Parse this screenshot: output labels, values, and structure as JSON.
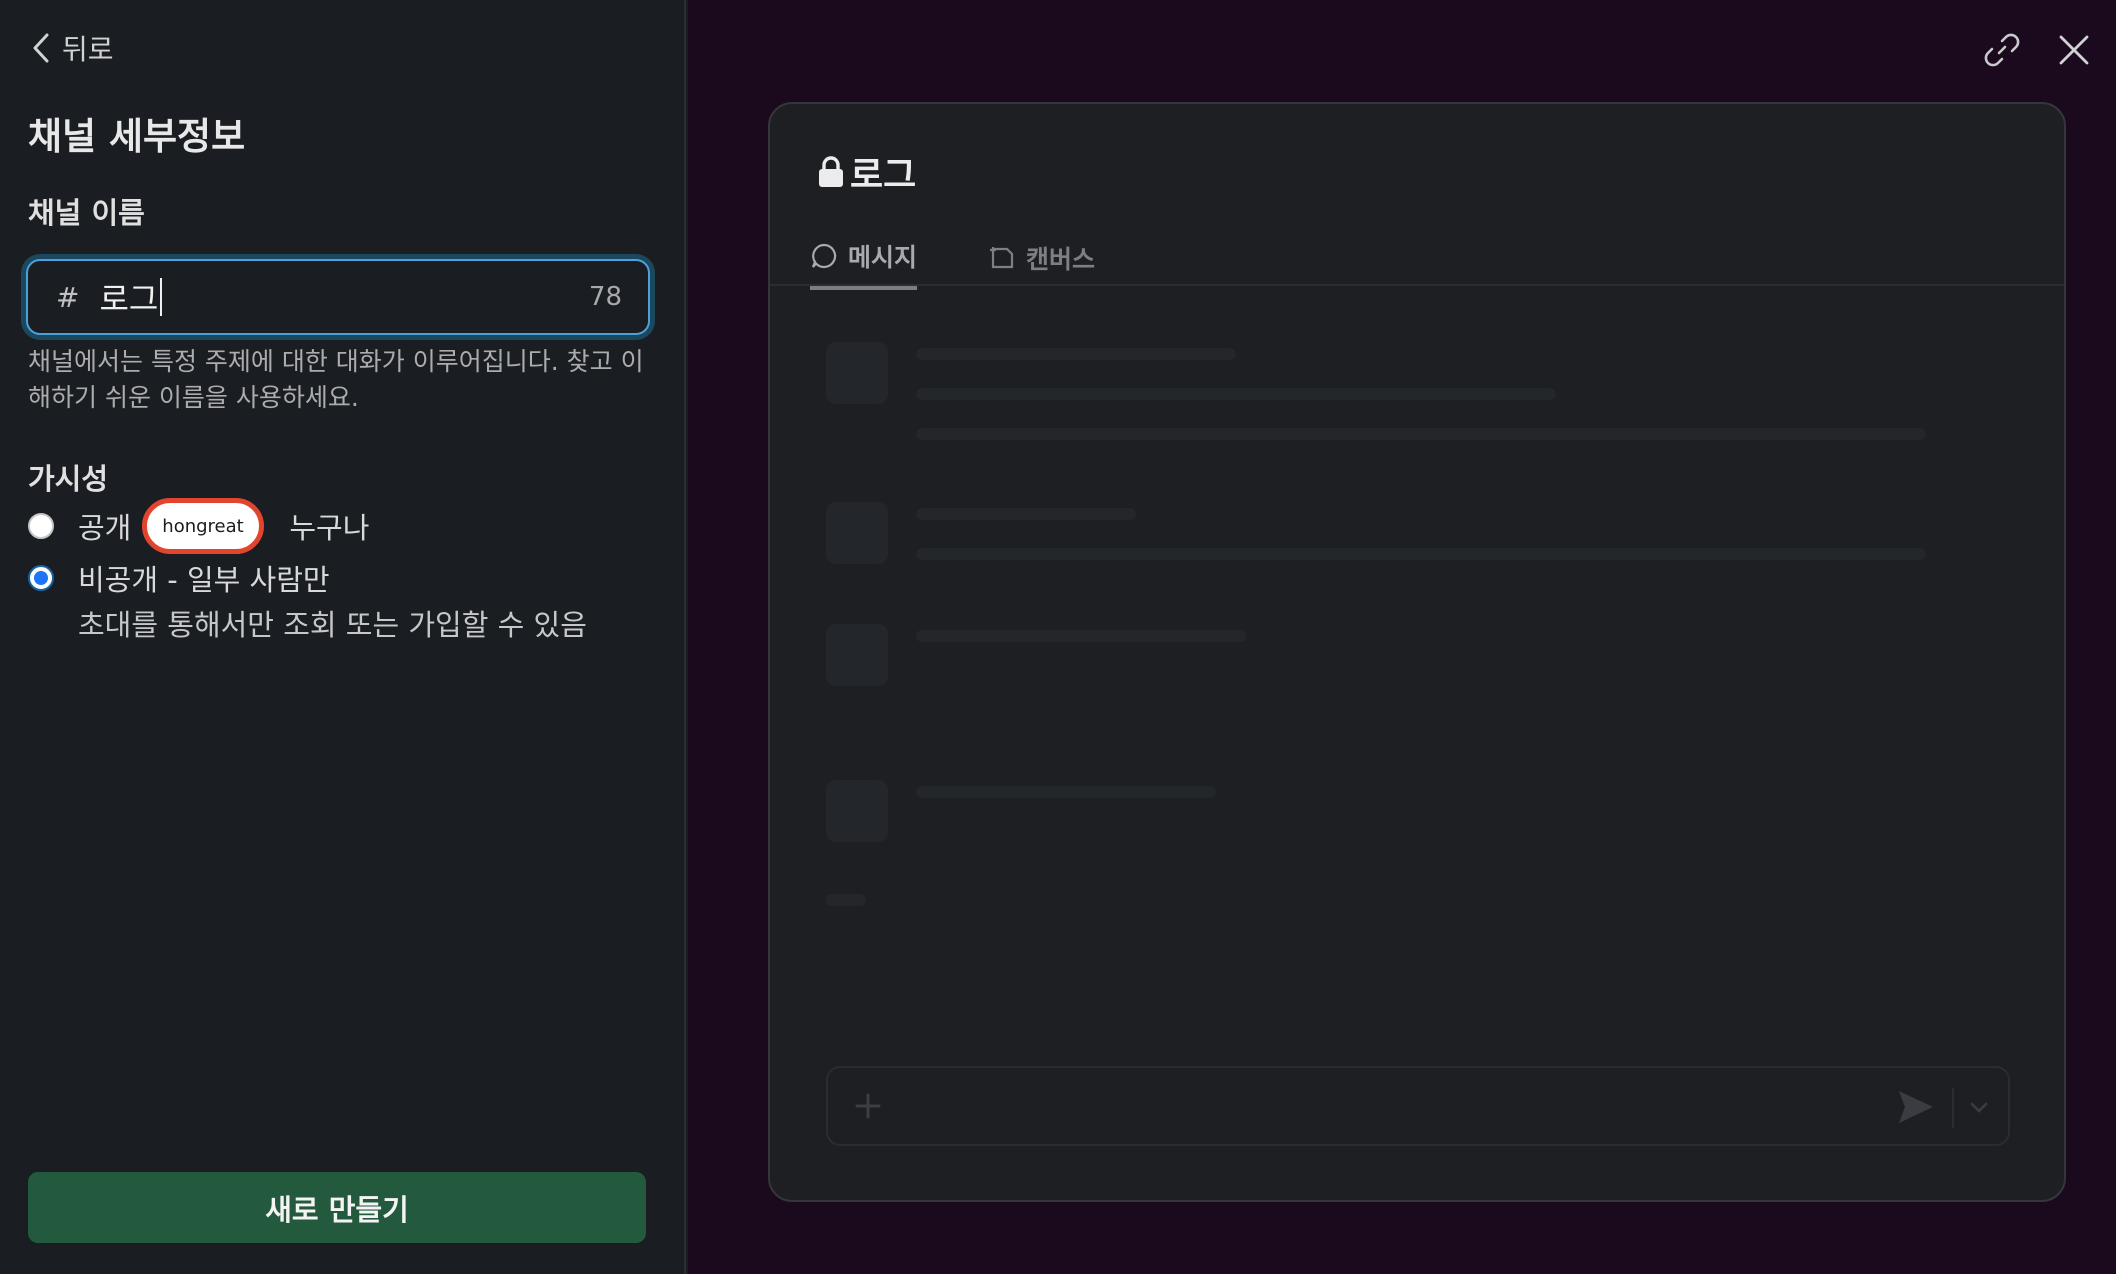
{
  "header": {
    "back_label": "뒤로"
  },
  "form": {
    "title": "채널 세부정보",
    "name_label": "채널 이름",
    "name_prefix": "#",
    "name_value": "로그",
    "name_remaining": "78",
    "hint": "채널에서는 특정 주제에 대한 대화가 이루어집니다. 찾고 이해하기 쉬운 이름을 사용하세요.",
    "visibility_label": "가시성",
    "options": [
      {
        "label_prefix": "공개",
        "label_suffix": "누구나",
        "selected": false
      },
      {
        "label": "비공개 - 일부 사람만",
        "description": "초대를 통해서만 조회 또는 가입할 수 있음",
        "selected": true
      }
    ],
    "overlay_tag": "hongreat",
    "submit_label": "새로 만들기"
  },
  "preview": {
    "channel_name": "로그",
    "tabs": [
      {
        "label": "메시지",
        "icon": "message-icon",
        "active": true
      },
      {
        "label": "캔버스",
        "icon": "canvas-icon",
        "active": false
      }
    ]
  },
  "icons": {
    "link": "link-icon",
    "close": "close-icon",
    "lock": "lock-icon",
    "plus": "plus-icon",
    "send": "send-icon",
    "chevron": "chevron-down-icon"
  },
  "colors": {
    "left_bg": "#1a1d21",
    "right_bg": "#1b0a1d",
    "accent_blue": "#1d74f5",
    "input_focus": "#4ea0d8",
    "submit_bg": "#235a3e",
    "tag_border": "#e2452d"
  }
}
